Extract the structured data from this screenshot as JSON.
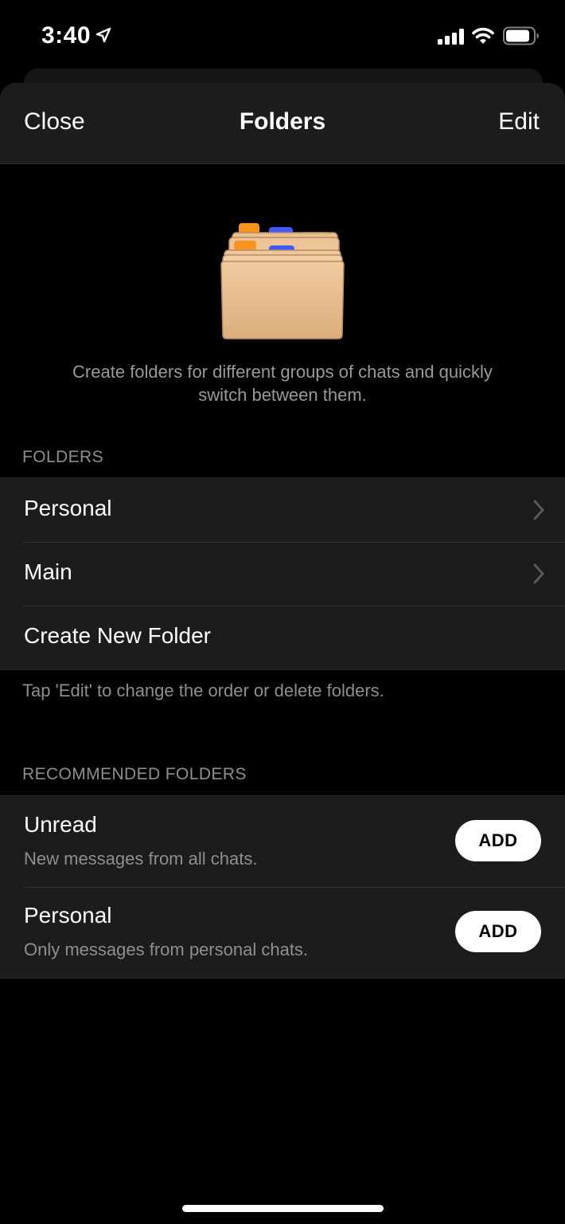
{
  "status_bar": {
    "time": "3:40",
    "icons": [
      "location-arrow-icon",
      "cellular-signal-icon",
      "wifi-icon",
      "battery-icon"
    ]
  },
  "nav": {
    "close_label": "Close",
    "title": "Folders",
    "edit_label": "Edit"
  },
  "intro": {
    "illustration": "folder-cabinet-icon",
    "text": "Create folders for different groups of chats and quickly switch between them."
  },
  "folders_section": {
    "header": "FOLDERS",
    "items": [
      {
        "label": "Personal",
        "has_chevron": true
      },
      {
        "label": "Main",
        "has_chevron": true
      },
      {
        "label": "Create New Folder",
        "has_chevron": false
      }
    ],
    "footer": "Tap 'Edit' to change the order or delete folders."
  },
  "recommended_section": {
    "header": "RECOMMENDED FOLDERS",
    "items": [
      {
        "title": "Unread",
        "subtitle": "New messages from all chats.",
        "button": "ADD"
      },
      {
        "title": "Personal",
        "subtitle": "Only messages from personal chats.",
        "button": "ADD"
      }
    ]
  },
  "colors": {
    "background": "#000000",
    "group_background": "#1c1c1d",
    "secondary_text": "#8e8e93",
    "button_background": "#ffffff"
  }
}
